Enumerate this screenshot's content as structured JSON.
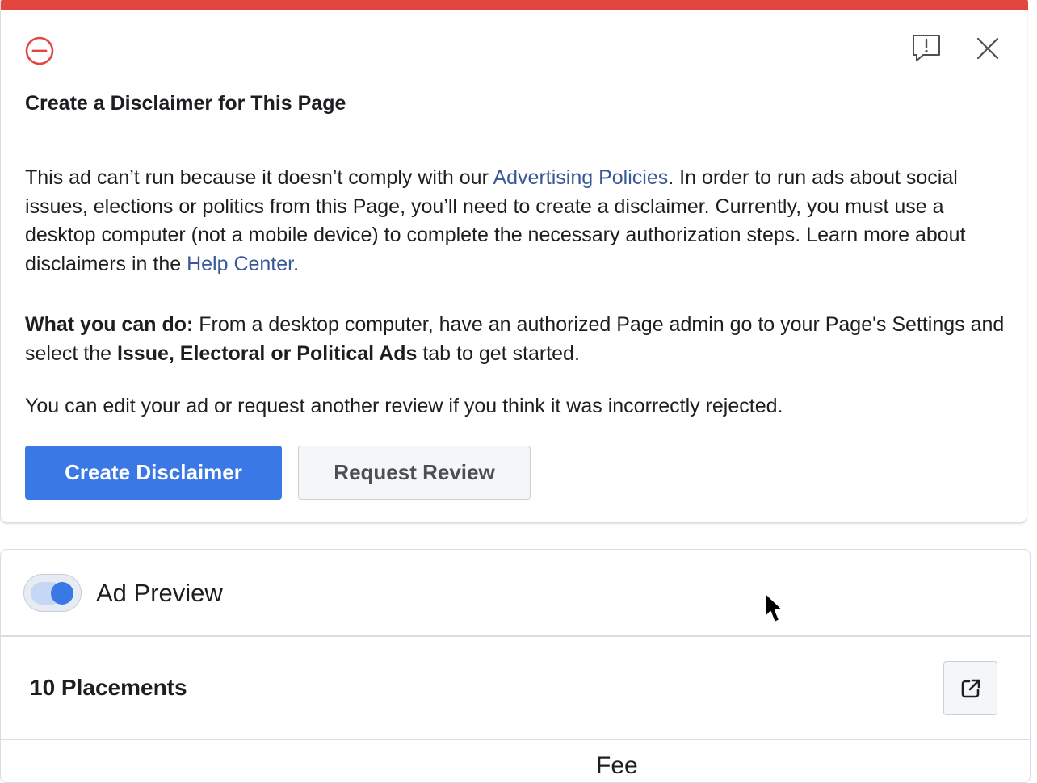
{
  "alert": {
    "title": "Create a Disclaimer for This Page",
    "p1_before_link": "This ad can’t run because it doesn’t comply with our ",
    "p1_link": "Advertising Policies",
    "p1_after_link": ". In order to run ads about social issues, elections or politics from this Page, you’ll need to create a disclaimer. Currently, you must use a desktop computer (not a mobile device) to complete the necessary authorization steps. Learn more about disclaimers in the ",
    "p1_link2": "Help Center",
    "p1_end": ".",
    "p2_bold_lead": "What you can do:",
    "p2_text_1": " From a desktop computer, have an authorized Page admin go to your Page's Settings and select the ",
    "p2_bold_tab": "Issue, Electoral or Political Ads",
    "p2_text_2": " tab to get started.",
    "p3": "You can edit your ad or request another review if you think it was incorrectly rejected.",
    "primary_button": "Create Disclaimer",
    "secondary_button": "Request Review",
    "icons": {
      "status": "error-circle-minus-icon",
      "feedback": "report-feedback-icon",
      "close": "close-icon"
    },
    "colors": {
      "top_bar": "#e2463f",
      "link": "#385898",
      "primary_button": "#3a78e6"
    }
  },
  "preview": {
    "toggle_label": "Ad Preview",
    "toggle_on": true,
    "placements_label": "10 Placements",
    "external_icon": "open-external-icon",
    "partial_next_text": "Fee"
  }
}
